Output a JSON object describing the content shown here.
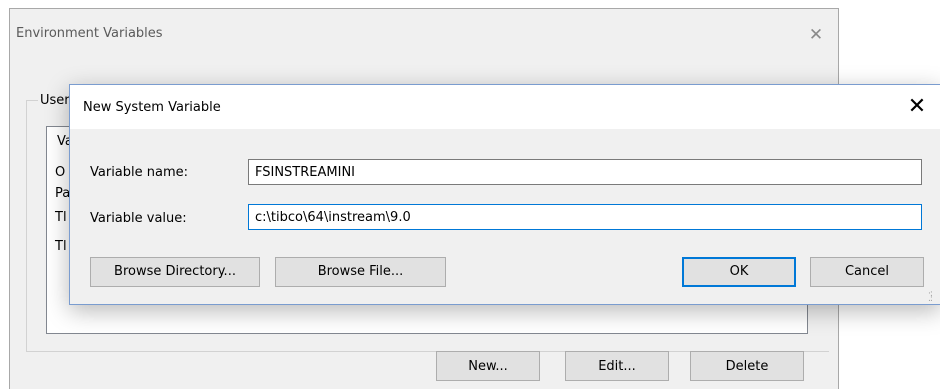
{
  "env_window": {
    "title": "Environment Variables",
    "close_glyph": "✕",
    "group_label": "User",
    "list_header": "Va",
    "rows": [
      "O",
      "Pa",
      "Tl",
      "Tl"
    ],
    "buttons": {
      "new_label": "New...",
      "edit_label": "Edit...",
      "delete_label": "Delete"
    }
  },
  "dialog": {
    "title": "New System Variable",
    "close_glyph": "✕",
    "name_label": "Variable name:",
    "name_value": "FSINSTREAMINI",
    "value_label": "Variable value:",
    "value_value": "c:\\tibco\\64\\instream\\9.0",
    "buttons": {
      "browse_directory": "Browse Directory...",
      "browse_file": "Browse File...",
      "ok": "OK",
      "cancel": "Cancel"
    }
  },
  "colors": {
    "accent": "#0078d7",
    "dialog_bg": "#f0f0f0",
    "button_bg": "#e1e1e1"
  },
  "icons": {
    "close": "close-icon",
    "grip": "resize-grip-icon"
  }
}
